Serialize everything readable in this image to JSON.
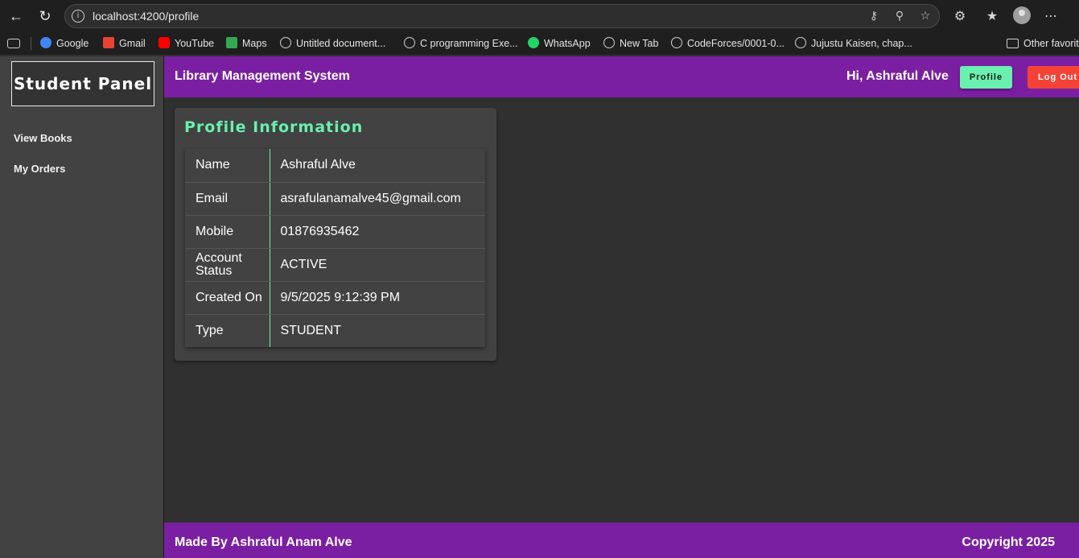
{
  "browser": {
    "url": "localhost:4200/profile",
    "bookmarks": [
      {
        "label": "Google",
        "icon": "google-icon",
        "color": "#4285f4"
      },
      {
        "label": "Gmail",
        "icon": "gmail-icon",
        "color": "#ea4335"
      },
      {
        "label": "YouTube",
        "icon": "youtube-icon",
        "color": "#ff0000"
      },
      {
        "label": "Maps",
        "icon": "maps-icon",
        "color": "#34a853"
      },
      {
        "label": "Untitled document...",
        "icon": "globe-icon"
      },
      {
        "label": "C programming Exe...",
        "icon": "globe-icon"
      },
      {
        "label": "WhatsApp",
        "icon": "whatsapp-icon",
        "color": "#25d366"
      },
      {
        "label": "New Tab",
        "icon": "globe-icon"
      },
      {
        "label": "CodeForces/0001-0...",
        "icon": "globe-icon"
      },
      {
        "label": "Jujustu Kaisen, chap...",
        "icon": "globe-icon"
      }
    ],
    "other_favorites": "Other favorit"
  },
  "sidebar": {
    "title": "Student Panel",
    "links": [
      "View Books",
      "My Orders"
    ]
  },
  "header": {
    "title": "Library Management System",
    "greeting": "Hi, Ashraful Alve",
    "profile_label": "Profile",
    "logout_label": "Log Out"
  },
  "profile": {
    "title": "Profile Information",
    "rows": [
      {
        "key": "Name",
        "value": "Ashraful Alve"
      },
      {
        "key": "Email",
        "value": "asrafulanamalve45@gmail.com"
      },
      {
        "key": "Mobile",
        "value": "01876935462"
      },
      {
        "key": "Account Status",
        "value": "ACTIVE"
      },
      {
        "key": "Created On",
        "value": "9/5/2025 9:12:39 PM"
      },
      {
        "key": "Type",
        "value": "STUDENT"
      }
    ]
  },
  "footer": {
    "left": "Made By Ashraful Anam Alve",
    "right": "Copyright 2025"
  },
  "colors": {
    "accent_purple": "#7b1fa2",
    "accent_green": "#69f0ae",
    "danger_red": "#f44336"
  }
}
